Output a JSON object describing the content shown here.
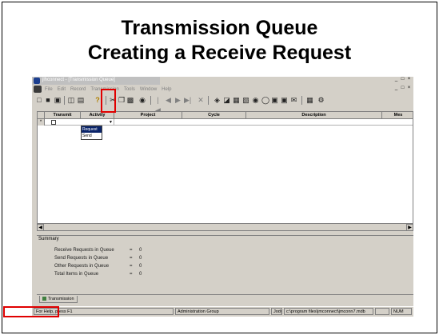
{
  "slide": {
    "title_line1": "Transmission Queue",
    "title_line2": "Creating a Receive Request"
  },
  "window": {
    "title": "jlhconnect - [Transmission Queue]",
    "controls": [
      "_",
      "□",
      "×"
    ]
  },
  "menu": {
    "items": [
      "File",
      "Edit",
      "Record",
      "Transmission",
      "Tools",
      "Window",
      "Help"
    ]
  },
  "toolbar": {
    "icons": [
      "new-icon",
      "open-icon",
      "save-icon",
      "print-preview-icon",
      "print-icon",
      "key-icon",
      "cut-icon",
      "copy-icon",
      "paste-icon",
      "find-icon",
      "first-record-icon",
      "prev-record-icon",
      "next-record-icon",
      "last-record-icon",
      "delete-record-icon"
    ]
  },
  "grid": {
    "columns": [
      "Transmit",
      "Activity",
      "Project",
      "Cycle",
      "Description",
      "Mes"
    ],
    "new_row_marker": "*",
    "activity_options": [
      "Request",
      "Send"
    ],
    "selected_option": "Request"
  },
  "summary": {
    "title": "Summary",
    "rows": [
      {
        "label": "Receive Requests in Queue",
        "eq": "=",
        "value": "0"
      },
      {
        "label": "Send Requests in Queue",
        "eq": "=",
        "value": "0"
      },
      {
        "label": "Other Requests in Queue",
        "eq": "=",
        "value": "0"
      },
      {
        "label": "Total Items in Queue",
        "eq": "=",
        "value": "0"
      }
    ]
  },
  "tab": {
    "label": "Transmission"
  },
  "status": {
    "help": "For Help, press F1",
    "group": "Administration Group",
    "user": "Jody",
    "path": "c:\\program files\\jmconnect\\jmconn7.mdb",
    "num": "NUM"
  },
  "colors": {
    "highlight": "#e00000",
    "selection": "#0a246a"
  }
}
